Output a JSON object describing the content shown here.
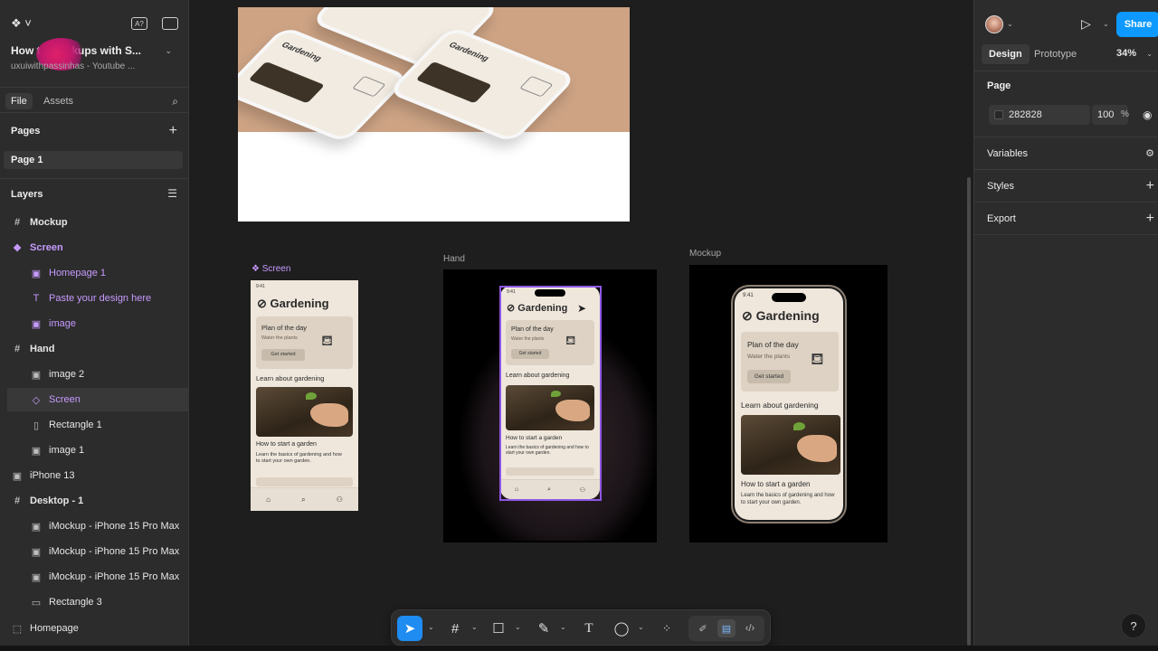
{
  "file": {
    "title": "How to Mockups with S...",
    "subtitle": "uxuiwithpassinhas - Youtube ..."
  },
  "left_tabs": {
    "file": "File",
    "assets": "Assets"
  },
  "pages": {
    "header": "Pages",
    "items": [
      {
        "label": "Page 1"
      }
    ]
  },
  "layers": {
    "header": "Layers",
    "items": [
      {
        "label": "Mockup",
        "icon": "frame-icon"
      },
      {
        "label": "Screen",
        "icon": "component-icon"
      },
      {
        "label": "Homepage 1",
        "icon": "image-icon"
      },
      {
        "label": "Paste your design here",
        "icon": "text-icon"
      },
      {
        "label": "image",
        "icon": "image-icon"
      },
      {
        "label": "Hand",
        "icon": "frame-icon"
      },
      {
        "label": "image 2",
        "icon": "image-icon"
      },
      {
        "label": "Screen",
        "icon": "instance-icon"
      },
      {
        "label": "Rectangle 1",
        "icon": "rectangle-icon"
      },
      {
        "label": "image 1",
        "icon": "image-icon"
      },
      {
        "label": "iPhone 13",
        "icon": "image-icon"
      },
      {
        "label": "Desktop - 1",
        "icon": "frame-icon"
      },
      {
        "label": "iMockup - iPhone 15 Pro Max",
        "icon": "image-icon"
      },
      {
        "label": "iMockup - iPhone 15 Pro Max",
        "icon": "image-icon"
      },
      {
        "label": "iMockup - iPhone 15 Pro Max",
        "icon": "image-icon"
      },
      {
        "label": "Rectangle 3",
        "icon": "rectangle-icon"
      },
      {
        "label": "Homepage",
        "icon": "section-icon"
      }
    ]
  },
  "canvas": {
    "labels": {
      "screen": "Screen",
      "hand": "Hand",
      "mockup": "Mockup"
    },
    "app": {
      "time": "9:41",
      "title": "Gardening",
      "card_title": "Plan of the day",
      "card_sub": "Water the plants",
      "card_button": "Get started",
      "section": "Learn about gardening",
      "article_title": "How to start a garden",
      "article_body": "Learn the basics of gardening and how to start your own garden."
    }
  },
  "right": {
    "share": "Share",
    "tabs": {
      "design": "Design",
      "prototype": "Prototype"
    },
    "zoom": "34%",
    "page_section": "Page",
    "page_color": "282828",
    "page_opacity": "100",
    "page_opacity_unit": "%",
    "variables": "Variables",
    "styles": "Styles",
    "export": "Export"
  },
  "colors": {
    "accent": "#0d99ff",
    "component": "#c79bff",
    "selection": "#8e57e6",
    "canvas": "#1e1e1e",
    "panel": "#2c2c2c"
  }
}
